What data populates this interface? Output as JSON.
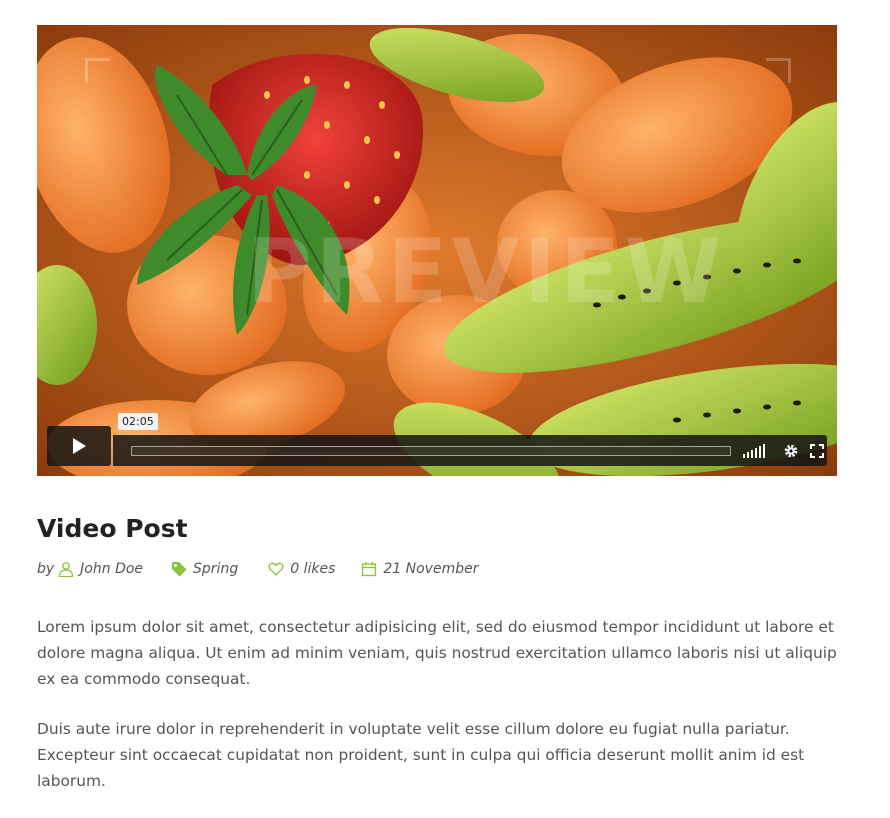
{
  "video": {
    "timestamp": "02:05",
    "progress": 0.0,
    "watermark": "PREVIEW"
  },
  "post": {
    "title": "Video Post",
    "by_label": "by",
    "author": "John Doe",
    "tag": "Spring",
    "likes": "0 likes",
    "date": "21 November",
    "paragraphs": [
      "Lorem ipsum dolor sit amet, consectetur adipisicing elit, sed do eiusmod tempor incididunt ut labore et dolore magna aliqua. Ut enim ad minim veniam, quis nostrud exercitation ullamco laboris nisi ut aliquip ex ea commodo consequat.",
      "Duis aute irure dolor in reprehenderit in voluptate velit esse cillum dolore eu fugiat nulla pariatur. Excepteur sint occaecat cupidatat non proident, sunt in culpa qui officia deserunt mollit anim id est laborum."
    ]
  },
  "icons": {
    "author": "user-icon",
    "tag": "tag-icon",
    "likes": "heart-icon",
    "date": "calendar-icon",
    "play": "play-icon",
    "volume": "volume-icon",
    "settings": "gear-icon",
    "fullscreen": "fullscreen-icon"
  },
  "colors": {
    "accent": "#8ac23b",
    "player_bar": "#141414",
    "text": "#555555",
    "title": "#222222"
  }
}
